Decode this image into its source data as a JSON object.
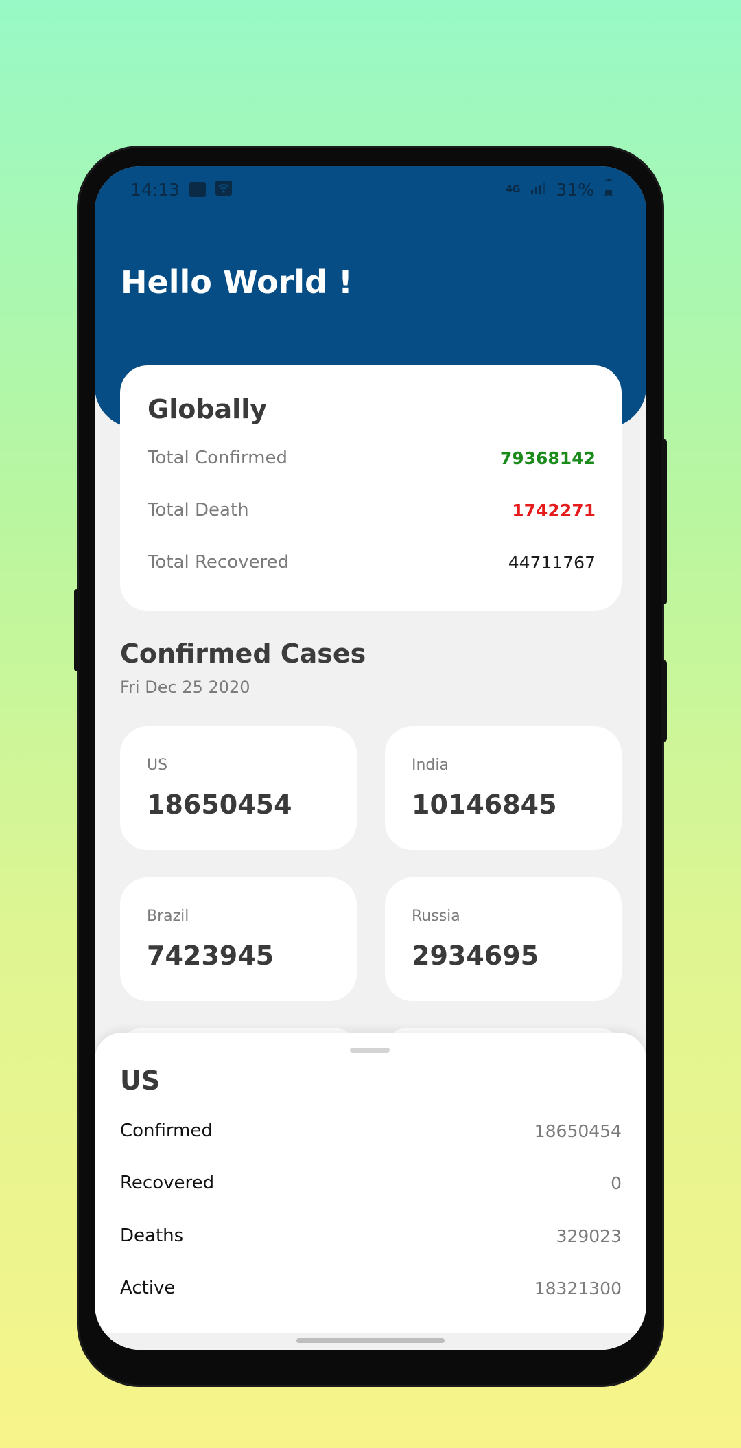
{
  "status_bar": {
    "time": "14:13",
    "network": "4G",
    "battery": "31%",
    "icons": [
      "image-icon",
      "wifi-icon",
      "signal-icon",
      "battery-icon"
    ]
  },
  "header": {
    "greeting": "Hello World !"
  },
  "global": {
    "title": "Globally",
    "rows": [
      {
        "label": "Total Confirmed",
        "value": "79368142",
        "color": "#1a8a1a"
      },
      {
        "label": "Total Death",
        "value": "1742271",
        "color": "#e51c1c"
      },
      {
        "label": "Total Recovered",
        "value": "44711767",
        "color": "#1b1b1b"
      }
    ]
  },
  "confirmed": {
    "title": "Confirmed Cases",
    "date": "Fri Dec 25 2020",
    "countries": [
      {
        "name": "US",
        "value": "18650454"
      },
      {
        "name": "India",
        "value": "10146845"
      },
      {
        "name": "Brazil",
        "value": "7423945"
      },
      {
        "name": "Russia",
        "value": "2934695"
      }
    ]
  },
  "sheet": {
    "title": "US",
    "rows": [
      {
        "label": "Confirmed",
        "value": "18650454"
      },
      {
        "label": "Recovered",
        "value": "0"
      },
      {
        "label": "Deaths",
        "value": "329023"
      },
      {
        "label": "Active",
        "value": "18321300"
      }
    ]
  },
  "colors": {
    "header_bg": "#054d84",
    "confirmed": "#1a8a1a",
    "death": "#e51c1c"
  }
}
